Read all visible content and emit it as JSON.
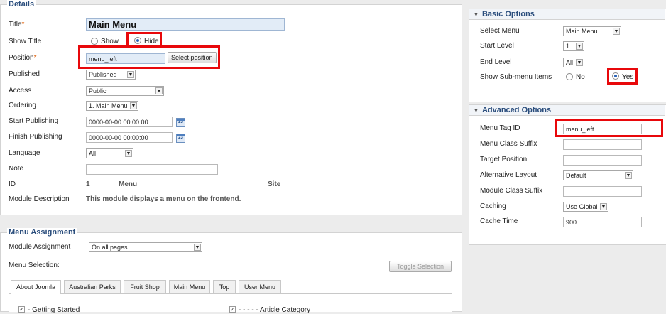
{
  "details": {
    "legend": "Details",
    "title_label": "Title",
    "title_value": "Main Menu",
    "show_title_label": "Show Title",
    "show_title_options": [
      "Show",
      "Hide"
    ],
    "position_label": "Position",
    "position_value": "menu_left",
    "select_position_button": "Select position",
    "published_label": "Published",
    "published_value": "Published",
    "access_label": "Access",
    "access_value": "Public",
    "ordering_label": "Ordering",
    "ordering_value": "1. Main Menu",
    "start_publishing_label": "Start Publishing",
    "start_publishing_value": "0000-00-00 00:00:00",
    "finish_publishing_label": "Finish Publishing",
    "finish_publishing_value": "0000-00-00 00:00:00",
    "calendar_text": "23",
    "language_label": "Language",
    "language_value": "All",
    "note_label": "Note",
    "note_value": "",
    "id_label": "ID",
    "id_value": "1",
    "id_module": "Menu",
    "id_site": "Site",
    "module_description_label": "Module Description",
    "module_description_value": "This module displays a menu on the frontend.",
    "required_mark": "*"
  },
  "menu_assignment": {
    "legend": "Menu Assignment",
    "module_assignment_label": "Module Assignment",
    "module_assignment_value": "On all pages",
    "menu_selection_label": "Menu Selection:",
    "toggle_selection_button": "Toggle Selection",
    "tabs": [
      "About Joomla",
      "Australian Parks",
      "Fruit Shop",
      "Main Menu",
      "Top",
      "User Menu"
    ],
    "items": [
      "- Getting Started",
      "- - - - - Article Category"
    ],
    "check_mark": "✓"
  },
  "basic_options": {
    "title": "Basic Options",
    "select_menu_label": "Select Menu",
    "select_menu_value": "Main Menu",
    "start_level_label": "Start Level",
    "start_level_value": "1",
    "end_level_label": "End Level",
    "end_level_value": "All",
    "show_submenu_label": "Show Sub-menu Items",
    "show_submenu_options": [
      "No",
      "Yes"
    ]
  },
  "advanced_options": {
    "title": "Advanced Options",
    "menu_tag_id_label": "Menu Tag ID",
    "menu_tag_id_value": "menu_left",
    "menu_class_suffix_label": "Menu Class Suffix",
    "menu_class_suffix_value": "",
    "target_position_label": "Target Position",
    "target_position_value": "",
    "alternative_layout_label": "Alternative Layout",
    "alternative_layout_value": "Default",
    "module_class_suffix_label": "Module Class Suffix",
    "module_class_suffix_value": "",
    "caching_label": "Caching",
    "caching_value": "Use Global",
    "cache_time_label": "Cache Time",
    "cache_time_value": "900"
  },
  "icons": {
    "dropdown_arrow": "▼",
    "section_toggle": "▼"
  },
  "colors": {
    "highlight": "#e8080b",
    "legend": "#2a4d7c",
    "required": "#e0620d"
  }
}
